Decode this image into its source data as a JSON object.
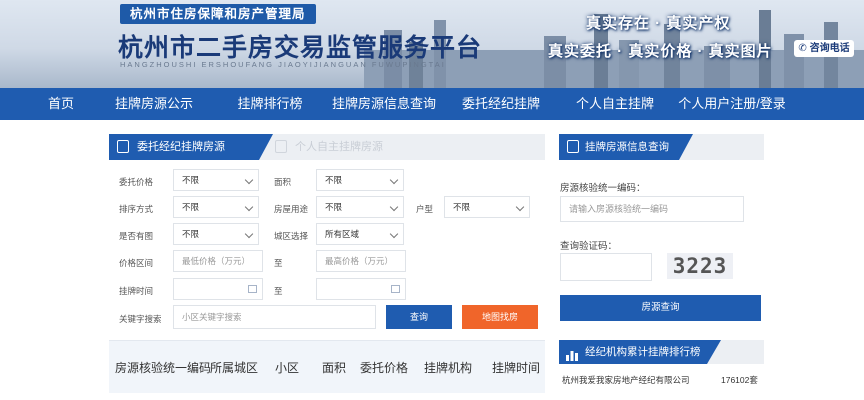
{
  "header": {
    "sub_tag": "杭州市住房保障和房产管理局",
    "title": "杭州市二手房交易监管服务平台",
    "pinyin": "HANGZHOUSHI ERSHOUFANG JIAOYIJIANGUAN FUWUPINGTAI",
    "slogan_1": "真实存在 · 真实产权",
    "slogan_2": "真实委托 · 真实价格 · 真实图片",
    "hotline": "咨询电话"
  },
  "nav": {
    "items": [
      "首页",
      "挂牌房源公示",
      "挂牌排行榜",
      "挂牌房源信息查询",
      "委托经纪挂牌",
      "个人自主挂牌",
      "个人用户注册/登录"
    ]
  },
  "search_panel": {
    "tabs": [
      "委托经纪挂牌房源",
      "个人自主挂牌房源"
    ],
    "fields": {
      "price_label": "委托价格",
      "price_value": "不限",
      "area_label": "面积",
      "area_value": "不限",
      "sort_label": "排序方式",
      "sort_value": "不限",
      "usage_label": "房屋用途",
      "usage_value": "不限",
      "layout_label": "户型",
      "layout_value": "不限",
      "photo_label": "是否有图",
      "photo_value": "不限",
      "district_label": "城区选择",
      "district_value": "所有区域",
      "price_range_label": "价格区间",
      "price_min_placeholder": "最低价格（万元）",
      "to_1": "至",
      "price_max_placeholder": "最高价格（万元）",
      "list_time_label": "挂牌时间",
      "to_2": "至",
      "keyword_label": "关键字搜索",
      "keyword_placeholder": "小区关键字搜索"
    },
    "search_button": "查询",
    "map_button": "地图找房"
  },
  "table": {
    "columns": [
      "房源核验统一编码",
      "所属城区",
      "小区",
      "面积",
      "委托价格",
      "挂牌机构",
      "挂牌时间"
    ]
  },
  "query_panel": {
    "title": "挂牌房源信息查询",
    "code_label": "房源核验统一编码：",
    "code_placeholder": "请输入房源核验统一编码",
    "captcha_label": "查询验证码：",
    "captcha_value": "3223",
    "submit_button": "房源查询"
  },
  "ranking": {
    "title": "经纪机构累计挂牌排行榜",
    "rows": [
      {
        "name": "杭州我爱我家房地产经纪有限公司",
        "count": "176102套"
      }
    ]
  },
  "colors": {
    "brand_blue": "#1f5cb0",
    "orange": "#f0652a",
    "light_bg": "#eceff3"
  }
}
